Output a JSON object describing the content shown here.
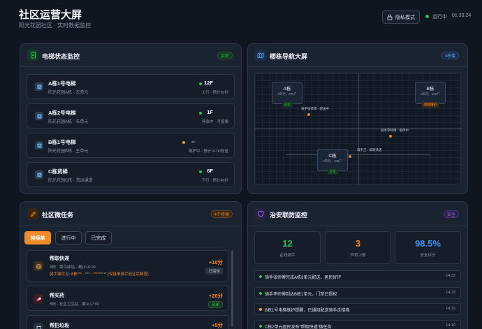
{
  "header": {
    "title": "社区运营大屏",
    "subtitle": "阳光花园社区 · 实时数据监控",
    "privacy_label": "隐私模式",
    "status_label": "运行中",
    "time": "01:33:24"
  },
  "elevator_panel": {
    "title": "电梯状态监控",
    "badge": "实时",
    "items": [
      {
        "name": "A栋1号电梯",
        "location": "阳光花园A栋 · 左单元",
        "floor": "12F",
        "status": "上行 · 预计30秒",
        "state_color": "#2fbf5b"
      },
      {
        "name": "A栋2号电梯",
        "location": "阳光花园A栋 · 右单元",
        "floor": "1F",
        "status": "停靠中 · 可搭乘",
        "state_color": "#2fbf5b"
      },
      {
        "name": "B栋1号电梯",
        "location": "阳光花园B栋 · 主单元",
        "floor": "--",
        "status": "维护中 · 预计16:00恢复",
        "state_color": "#f0a030"
      },
      {
        "name": "C栋货梯",
        "location": "阳光花园C栋 · 货运通道",
        "floor": "6F",
        "status": "下行 · 预计45秒",
        "state_color": "#2fbf5b"
      }
    ]
  },
  "map_panel": {
    "title": "楼栋导航大屏",
    "badge": "3栋楼",
    "buildings": [
      {
        "name": "A栋",
        "info": "3单元 · 286户",
        "tag": "正常"
      },
      {
        "name": "B栋",
        "info": "2单元 · 198户",
        "tag": "电梯维护"
      },
      {
        "name": "C栋",
        "info": "2单元 · 168户",
        "tag": "正常"
      }
    ],
    "riders": [
      {
        "label": "骑手张师傅 · 配送中"
      },
      {
        "label": "骑手李师傅 · 取件中"
      },
      {
        "label": "骑手王 · 帮取快递"
      }
    ]
  },
  "task_panel": {
    "title": "社区微任务",
    "badge": "4个待接",
    "tabs": [
      {
        "label": "待接单"
      },
      {
        "label": "进行中"
      },
      {
        "label": "已完成"
      }
    ],
    "tasks": [
      {
        "title": "帮取快递",
        "meta": "A栋 · 菜鸟驿站 · 截止16:00",
        "password": "骑手端可见: A栋*** · *** · ********* (仅接单骑手验证后解密)",
        "reward": "+10分",
        "action": "已接单"
      },
      {
        "title": "帮买药",
        "meta": "B栋 · 社区卫生站 · 截止17:00",
        "reward": "+20分",
        "action": "接单"
      },
      {
        "title": "帮扔垃圾",
        "reward": "+5分"
      }
    ]
  },
  "security_panel": {
    "title": "治安联防监控",
    "badge": "安全",
    "stats": [
      {
        "value": "12",
        "label": "在线骑手",
        "color": "#2fbf5b"
      },
      {
        "value": "3",
        "label": "异常上报",
        "color": "#f28c28"
      },
      {
        "value": "98.5%",
        "label": "安全评分",
        "color": "#3d8ef0"
      }
    ],
    "events": [
      {
        "text": "骑手张师傅完成A栋3单元配送，居民好评",
        "time": "14:32",
        "color": "#2fbf5b"
      },
      {
        "text": "骑手李师傅到达B栋1单元，门禁已授权",
        "time": "14:28",
        "color": "#2fbf5b"
      },
      {
        "text": "B栋1号电梯维护提醒，已通知配送骑手走楼梯",
        "time": "14:15",
        "color": "#f0a030"
      },
      {
        "text": "C栋2单元居民发布“帮取快递”微任务",
        "time": "14:10",
        "color": "#2fbf5b"
      }
    ]
  }
}
